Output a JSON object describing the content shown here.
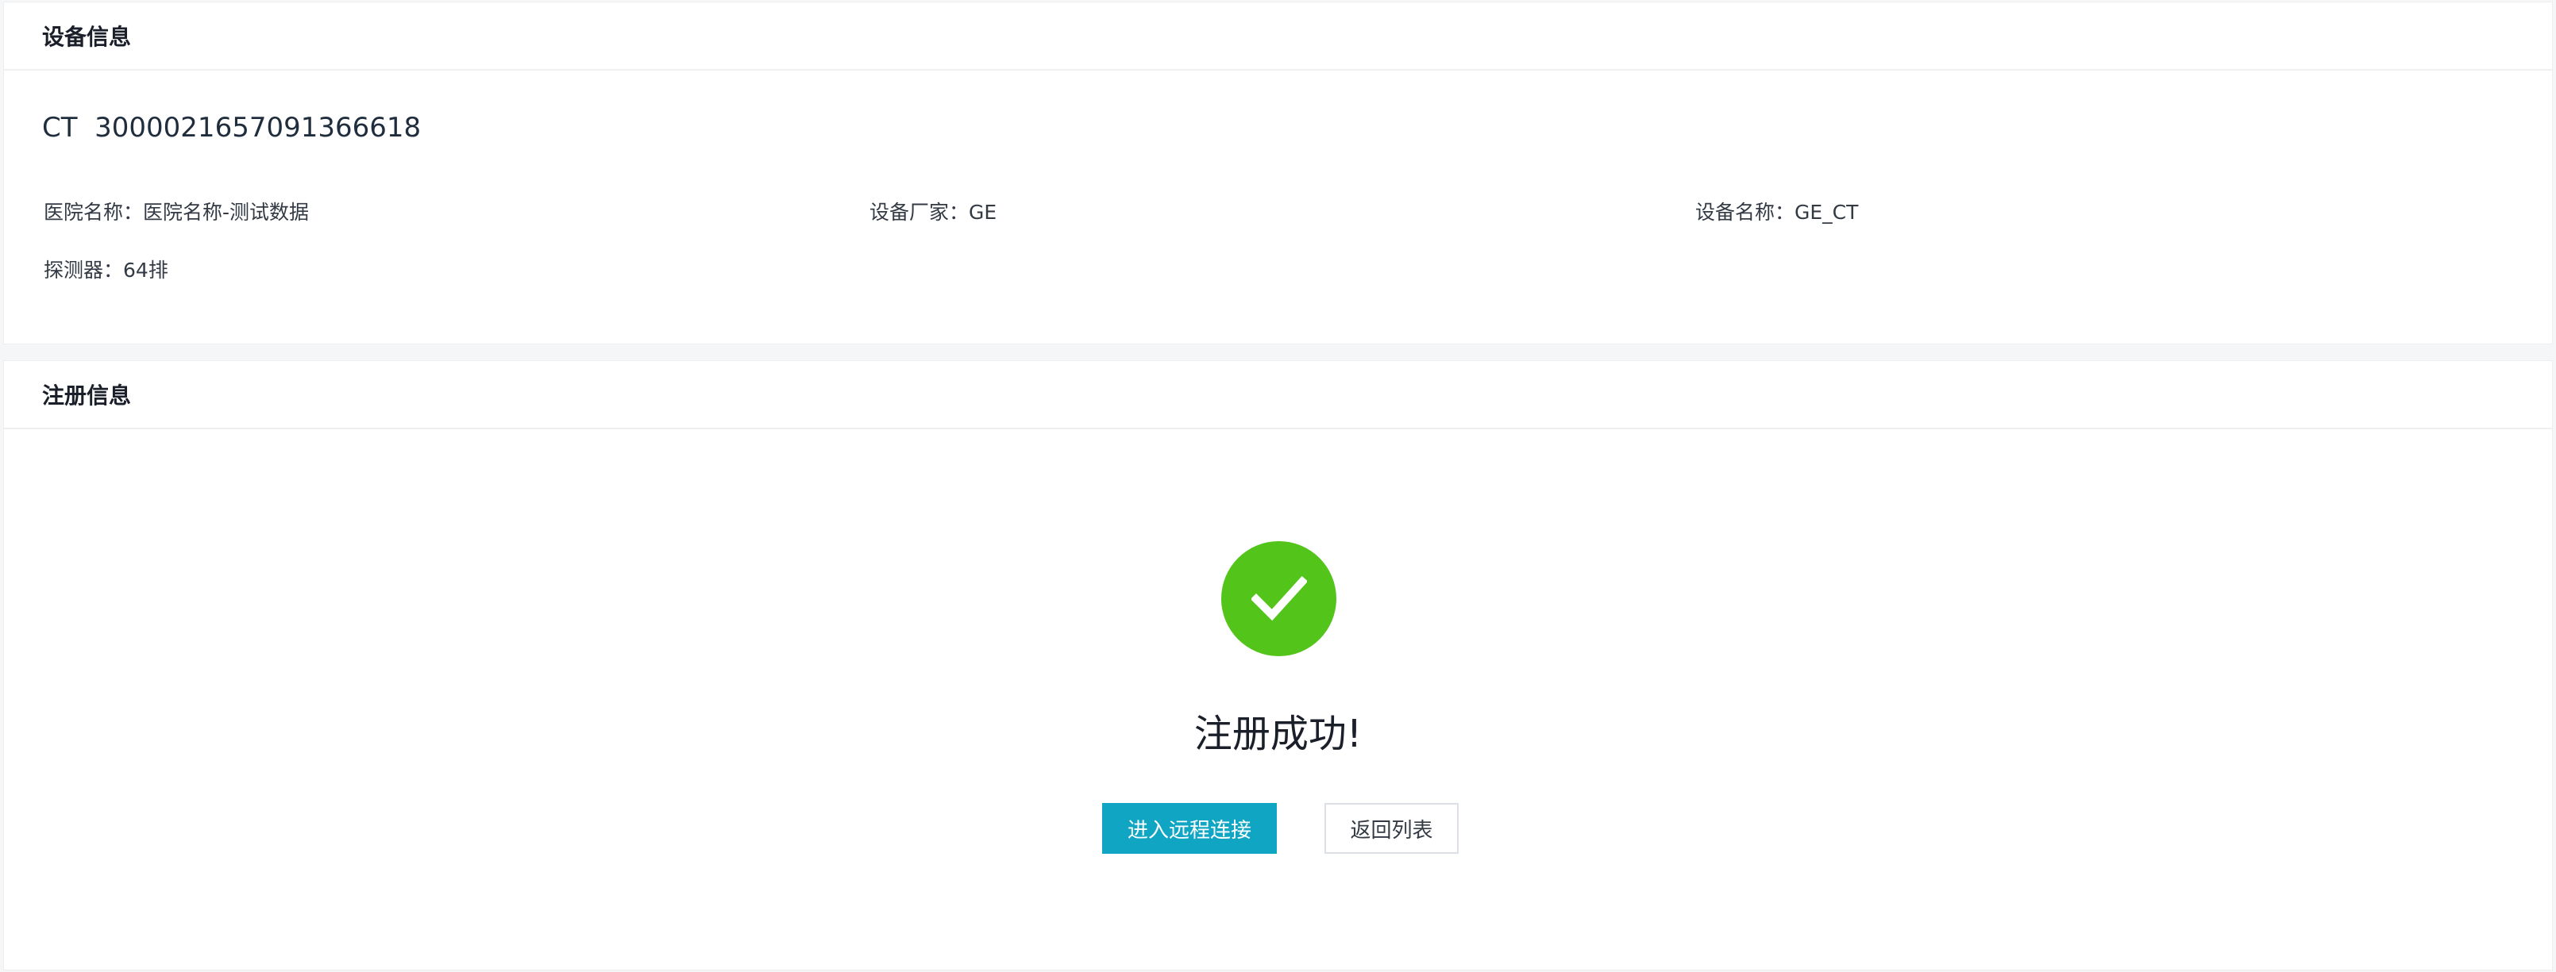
{
  "device_section": {
    "title": "设备信息",
    "device_type": "CT",
    "device_code": "3000021657091366618",
    "fields": {
      "hospital": {
        "label": "医院名称：",
        "value": "医院名称-测试数据"
      },
      "vendor": {
        "label": "设备厂家：",
        "value": "GE"
      },
      "device_name": {
        "label": "设备名称：",
        "value": "GE_CT"
      },
      "detector": {
        "label": "探测器：",
        "value": "64排"
      }
    }
  },
  "registration_section": {
    "title": "注册信息",
    "icon": "check-circle-icon",
    "success_color": "#52c41a",
    "message": "注册成功!",
    "buttons": {
      "remote": "进入远程连接",
      "back": "返回列表"
    },
    "primary_color": "#10a6c3"
  }
}
